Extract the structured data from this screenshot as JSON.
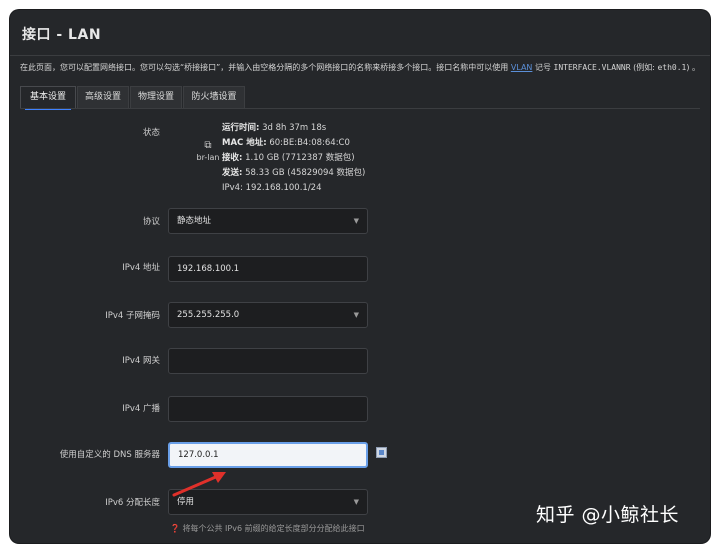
{
  "window": {
    "title": "接口 - LAN"
  },
  "description": {
    "pre": "在此页面，您可以配置网络接口。您可以勾选“桥接接口”，并输入由空格分隔的多个网络接口的名称来桥接多个接口。接口名称中可以使用 ",
    "link": "VLAN",
    "mid": " 记号 ",
    "code1": "INTERFACE.VLANNR",
    "mid2": " (例如: ",
    "code2": "eth0.1",
    "post": ") 。"
  },
  "tabs": [
    "基本设置",
    "高级设置",
    "物理设置",
    "防火墙设置"
  ],
  "status": {
    "label": "状态",
    "icon": "network-adapter-icon",
    "iface": "br-lan",
    "uptime_label": "运行时间:",
    "uptime": "3d 8h 37m 18s",
    "mac_label": "MAC 地址:",
    "mac": "60:BE:B4:08:64:C0",
    "rx_label": "接收:",
    "rx": "1.10 GB (7712387 数据包)",
    "tx_label": "发送:",
    "tx": "58.33 GB (45829094 数据包)",
    "ipv4": "IPv4: 192.168.100.1/24"
  },
  "fields": {
    "protocol": {
      "label": "协议",
      "value": "静态地址"
    },
    "ipv4_addr": {
      "label": "IPv4 地址",
      "value": "192.168.100.1"
    },
    "netmask": {
      "label": "IPv4 子网掩码",
      "value": "255.255.255.0"
    },
    "gateway": {
      "label": "IPv4 网关",
      "value": ""
    },
    "broadcast": {
      "label": "IPv4 广播",
      "value": ""
    },
    "dns": {
      "label": "使用自定义的 DNS 服务器",
      "value": "127.0.0.1"
    },
    "ipv6_len": {
      "label": "IPv6 分配长度",
      "value": "停用"
    }
  },
  "hint": "❓ 将每个公共 IPv6 前缀的给定长度部分分配给此接口",
  "watermark": "知乎 @小鲸社长",
  "colors": {
    "accent": "#3f82ff",
    "background": "#25272a",
    "annotation_arrow": "#e0302a"
  }
}
